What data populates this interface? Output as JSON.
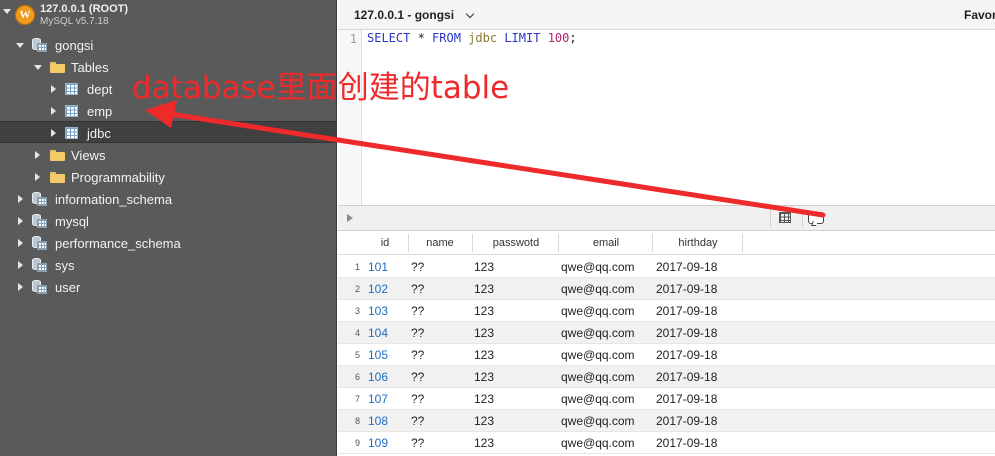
{
  "connection": {
    "host": "127.0.0.1 (ROOT)",
    "version": "MySQL v5.7.18",
    "tab_title": "127.0.0.1 - gongsi",
    "favorites_label": "Favor"
  },
  "sidebar": {
    "gongsi": "gongsi",
    "tables_folder": "Tables",
    "tables": [
      "dept",
      "emp",
      "jdbc"
    ],
    "views_folder": "Views",
    "programmability_folder": "Programmability",
    "databases": [
      "information_schema",
      "mysql",
      "performance_schema",
      "sys",
      "user"
    ]
  },
  "editor": {
    "line_number": "1",
    "query": {
      "select": "SELECT",
      "star": " * ",
      "from": "FROM",
      "table": "jdbc",
      "limit": "LIMIT",
      "count": "100",
      "semicolon": ";"
    }
  },
  "results": {
    "columns": [
      "id",
      "name",
      "passwotd",
      "email",
      "hirthday"
    ],
    "rows": [
      {
        "n": "1",
        "id": "101",
        "name": "??",
        "pwd": "123",
        "email": "qwe@qq.com",
        "date": "2017-09-18"
      },
      {
        "n": "2",
        "id": "102",
        "name": "??",
        "pwd": "123",
        "email": "qwe@qq.com",
        "date": "2017-09-18"
      },
      {
        "n": "3",
        "id": "103",
        "name": "??",
        "pwd": "123",
        "email": "qwe@qq.com",
        "date": "2017-09-18"
      },
      {
        "n": "4",
        "id": "104",
        "name": "??",
        "pwd": "123",
        "email": "qwe@qq.com",
        "date": "2017-09-18"
      },
      {
        "n": "5",
        "id": "105",
        "name": "??",
        "pwd": "123",
        "email": "qwe@qq.com",
        "date": "2017-09-18"
      },
      {
        "n": "6",
        "id": "106",
        "name": "??",
        "pwd": "123",
        "email": "qwe@qq.com",
        "date": "2017-09-18"
      },
      {
        "n": "7",
        "id": "107",
        "name": "??",
        "pwd": "123",
        "email": "qwe@qq.com",
        "date": "2017-09-18"
      },
      {
        "n": "8",
        "id": "108",
        "name": "??",
        "pwd": "123",
        "email": "qwe@qq.com",
        "date": "2017-09-18"
      },
      {
        "n": "9",
        "id": "109",
        "name": "??",
        "pwd": "123",
        "email": "qwe@qq.com",
        "date": "2017-09-18"
      }
    ]
  },
  "annotation": {
    "text": "database里面创建的table",
    "color": "#ee2a2a"
  },
  "icons": {
    "connection": "sequel-logo-icon",
    "database": "database-icon",
    "folder": "folder-icon",
    "table": "table-icon",
    "grid_view": "grid-view-icon",
    "messages": "messages-icon"
  }
}
